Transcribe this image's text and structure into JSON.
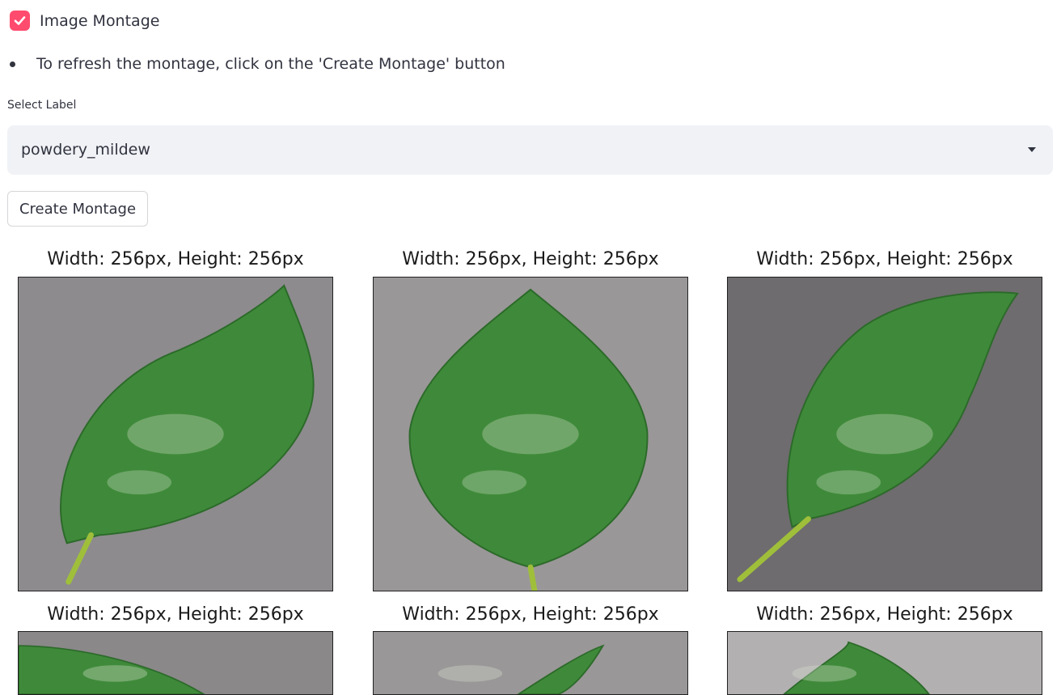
{
  "checkbox": {
    "label": "Image Montage",
    "checked": true,
    "color": "#ff4b6e"
  },
  "info_bullet": "To refresh the montage, click on the 'Create Montage' button",
  "select": {
    "label": "Select Label",
    "value": "powdery_mildew"
  },
  "create_button": {
    "label": "Create Montage"
  },
  "montage": {
    "images": [
      {
        "caption": "Width: 256px, Height: 256px",
        "subject": "powdery mildew leaf"
      },
      {
        "caption": "Width: 256px, Height: 256px",
        "subject": "powdery mildew leaf"
      },
      {
        "caption": "Width: 256px, Height: 256px",
        "subject": "powdery mildew leaf"
      },
      {
        "caption": "Width: 256px, Height: 256px",
        "subject": "powdery mildew leaf"
      },
      {
        "caption": "Width: 256px, Height: 256px",
        "subject": "powdery mildew leaf"
      },
      {
        "caption": "Width: 256px, Height: 256px",
        "subject": "powdery mildew leaf"
      }
    ]
  }
}
